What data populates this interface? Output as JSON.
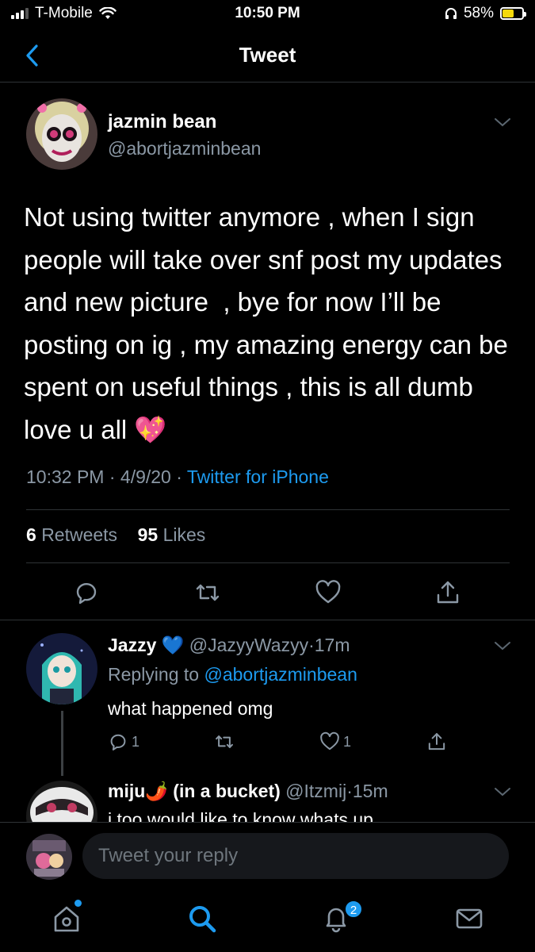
{
  "status_bar": {
    "carrier": "T-Mobile",
    "time": "10:50 PM",
    "battery_percent": "58%",
    "battery_level": 0.58,
    "icons": [
      "signal-icon",
      "wifi-icon",
      "headphones-icon",
      "battery-charging-icon"
    ]
  },
  "header": {
    "title": "Tweet",
    "back_icon": "chevron-left-icon"
  },
  "tweet": {
    "author_name": "jazmin bean",
    "author_handle": "@abortjazminbean",
    "text": "Not using twitter anymore , when I sign people will take over snf post my updates and new picture  , bye for now I’ll be posting on ig , my amazing energy can be spent on useful things , this is all dumb love u all 💖",
    "time": "10:32 PM",
    "date": "4/9/20",
    "separator": "·",
    "source": "Twitter for iPhone",
    "retweets_count": "6",
    "retweets_label": "Retweets",
    "likes_count": "95",
    "likes_label": "Likes"
  },
  "replies": [
    {
      "name": "Jazzy 💙",
      "handle": "@JazyyWazyy",
      "time": "17m",
      "replying_label": "Replying to",
      "replying_to": "@abortjazminbean",
      "text": "what happened omg",
      "reply_count": "1",
      "like_count": "1"
    },
    {
      "name": "miju🌶️ (in a bucket)",
      "handle": "@Itzmij",
      "time": "15m",
      "text": "i too would like to know whats up"
    }
  ],
  "compose": {
    "placeholder": "Tweet your reply"
  },
  "tab_bar": {
    "notifications_badge": "2",
    "tabs": [
      "home-icon",
      "search-icon",
      "notifications-icon",
      "messages-icon"
    ]
  },
  "colors": {
    "accent": "#1d9bf0",
    "background": "#000000",
    "secondary_text": "#8b98a5"
  }
}
